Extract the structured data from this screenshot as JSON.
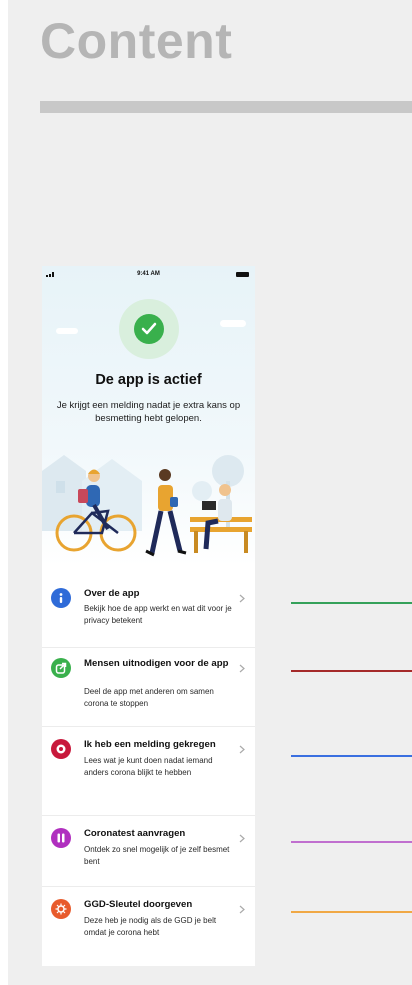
{
  "page": {
    "heading": "Content"
  },
  "status_bar": {
    "time": "9:41 AM"
  },
  "hero": {
    "title": "De app is actief",
    "subtitle": "Je krijgt een melding nadat je extra kans op besmetting hebt gelopen."
  },
  "items": [
    {
      "icon": "info-icon",
      "color": "#2f6bd8",
      "title": "Over de app",
      "description": "Bekijk hoe de app werkt en wat dit voor je privacy betekent",
      "line_color": "#35a15a"
    },
    {
      "icon": "share-icon",
      "color": "#39b04c",
      "title": "Mensen uitnodigen voor de app",
      "description": "Deel de app met anderen om samen corona te stoppen",
      "line_color": "#a52a2a"
    },
    {
      "icon": "alert-icon",
      "color": "#c8193c",
      "title": "Ik heb een melding gekregen",
      "description": "Lees wat je kunt doen nadat iemand anders corona blijkt te hebben",
      "line_color": "#3a6fe0"
    },
    {
      "icon": "test-icon",
      "color": "#b02fbf",
      "title": "Coronatest aanvragen",
      "description": "Ontdek zo snel mogelijk of je zelf besmet bent",
      "line_color": "#c06fcf"
    },
    {
      "icon": "virus-icon",
      "color": "#e85b2c",
      "title": "GGD-Sleutel doorgeven",
      "description": "Deze heb je nodig als de GGD je belt omdat je corona hebt",
      "line_color": "#f0a845"
    }
  ]
}
